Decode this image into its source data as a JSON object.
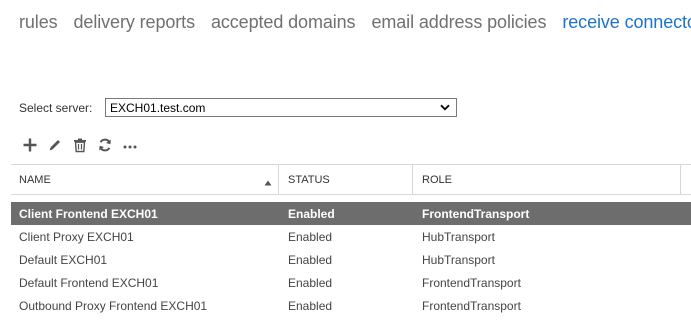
{
  "tabs": [
    {
      "label": "rules"
    },
    {
      "label": "delivery reports"
    },
    {
      "label": "accepted domains"
    },
    {
      "label": "email address policies"
    },
    {
      "label": "receive connectors",
      "active": true
    }
  ],
  "server_selector": {
    "label": "Select server:",
    "value": "EXCH01.test.com"
  },
  "toolbar": {
    "icons": [
      "add-icon",
      "edit-icon",
      "delete-icon",
      "refresh-icon",
      "more-options-icon"
    ]
  },
  "table": {
    "columns": [
      "NAME",
      "STATUS",
      "ROLE"
    ],
    "sort_column": "NAME",
    "sort_direction": "ascending",
    "rows": [
      {
        "name": "Client Frontend EXCH01",
        "status": "Enabled",
        "role": "FrontendTransport",
        "selected": true
      },
      {
        "name": "Client Proxy EXCH01",
        "status": "Enabled",
        "role": "HubTransport"
      },
      {
        "name": "Default EXCH01",
        "status": "Enabled",
        "role": "HubTransport"
      },
      {
        "name": "Default Frontend EXCH01",
        "status": "Enabled",
        "role": "FrontendTransport"
      },
      {
        "name": "Outbound Proxy Frontend EXCH01",
        "status": "Enabled",
        "role": "FrontendTransport"
      }
    ]
  },
  "colors": {
    "active_tab": "#1e73c8",
    "inactive_tab": "#707070",
    "selected_row": "#6d6d6d"
  }
}
